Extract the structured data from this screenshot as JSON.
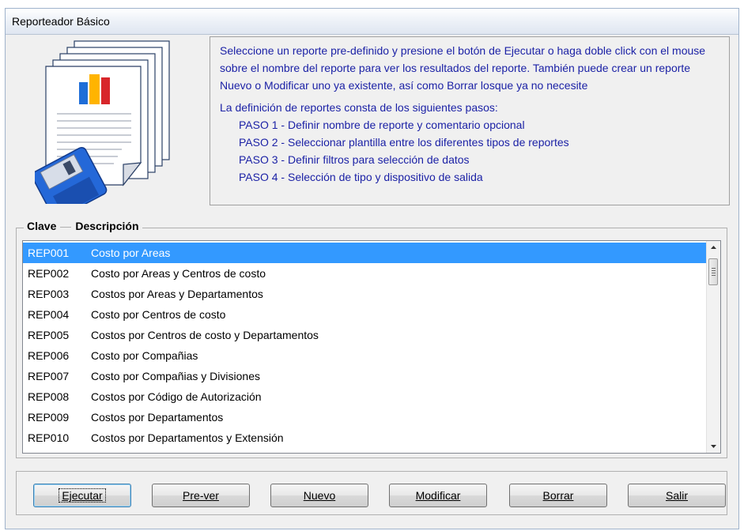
{
  "window": {
    "title": "Reporteador Básico"
  },
  "info": {
    "intro": "Seleccione un reporte pre-definido y presione el botón de Ejecutar o haga doble click con el mouse sobre el nombre del reporte para ver los resultados del reporte. También puede crear un reporte Nuevo o Modificar uno ya existente, así como Borrar losque ya no necesite",
    "steps_header": "La definición de reportes consta de los siguientes pasos:",
    "steps": [
      "PASO 1 - Definir nombre de reporte y comentario opcional",
      "PASO 2 - Seleccionar plantilla entre los diferentes tipos de reportes",
      "PASO 3 - Definir filtros para selección de datos",
      "PASO 4 - Selección de tipo y dispositivo de salida"
    ]
  },
  "list": {
    "header_code": "Clave",
    "header_desc": "Descripción",
    "selected_index": 0,
    "rows": [
      {
        "code": "REP001",
        "desc": "Costo por Areas"
      },
      {
        "code": "REP002",
        "desc": "Costo por Areas y Centros de costo"
      },
      {
        "code": "REP003",
        "desc": "Costos por Areas y Departamentos"
      },
      {
        "code": "REP004",
        "desc": "Costo por Centros de costo"
      },
      {
        "code": "REP005",
        "desc": "Costos por Centros de costo y Departamentos"
      },
      {
        "code": "REP006",
        "desc": "Costo por Compañias"
      },
      {
        "code": "REP007",
        "desc": "Costo por Compañias y Divisiones"
      },
      {
        "code": "REP008",
        "desc": "Costos por Código de Autorización"
      },
      {
        "code": "REP009",
        "desc": "Costos por Departamentos"
      },
      {
        "code": "REP010",
        "desc": "Costos por Departamentos y Extensión"
      }
    ]
  },
  "buttons": {
    "execute": "Ejecutar",
    "preview": "Pre-ver",
    "new": "Nuevo",
    "modify": "Modificar",
    "delete": "Borrar",
    "exit": "Salir"
  },
  "colors": {
    "info_text": "#1c22a6",
    "selection": "#3399ff",
    "window_bg": "#f0f0f0"
  },
  "icons": {
    "illustration": "report-documents-with-floppy-icon",
    "scroll_up": "scroll-up-arrow-icon",
    "scroll_down": "scroll-down-arrow-icon"
  }
}
